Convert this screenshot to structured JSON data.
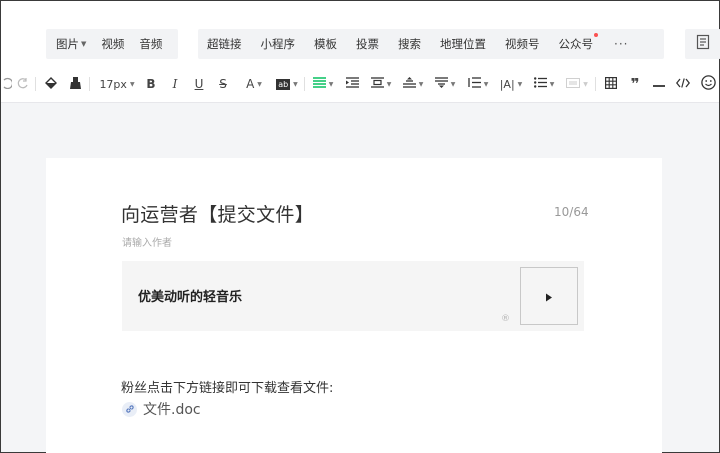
{
  "insert_bar": {
    "group1": [
      {
        "label": "图片",
        "has_caret": true
      },
      {
        "label": "视频",
        "has_caret": false
      },
      {
        "label": "音频",
        "has_caret": false
      }
    ],
    "group2": [
      {
        "label": "超链接"
      },
      {
        "label": "小程序"
      },
      {
        "label": "模板"
      },
      {
        "label": "投票"
      },
      {
        "label": "搜索"
      },
      {
        "label": "地理位置"
      },
      {
        "label": "视频号"
      },
      {
        "label": "公众号",
        "badge": true
      }
    ],
    "more_label": "···"
  },
  "format_toolbar": {
    "font_size": "17px",
    "bold": "B",
    "italic": "I",
    "underline": "U",
    "strike": "S",
    "font_color": "A",
    "bg_color": "ab",
    "letter_spacing": "|A|"
  },
  "editor": {
    "title": "向运营者【提交文件】",
    "title_count": "10/64",
    "author_placeholder": "请输入作者",
    "music": {
      "title": "优美动听的轻音乐",
      "copyright_mark": "®"
    },
    "paragraph": "粉丝点击下方链接即可下载查看文件:",
    "file_name": "文件.doc"
  },
  "colors": {
    "accent_green": "#07c160",
    "badge_red": "#fa5151"
  }
}
